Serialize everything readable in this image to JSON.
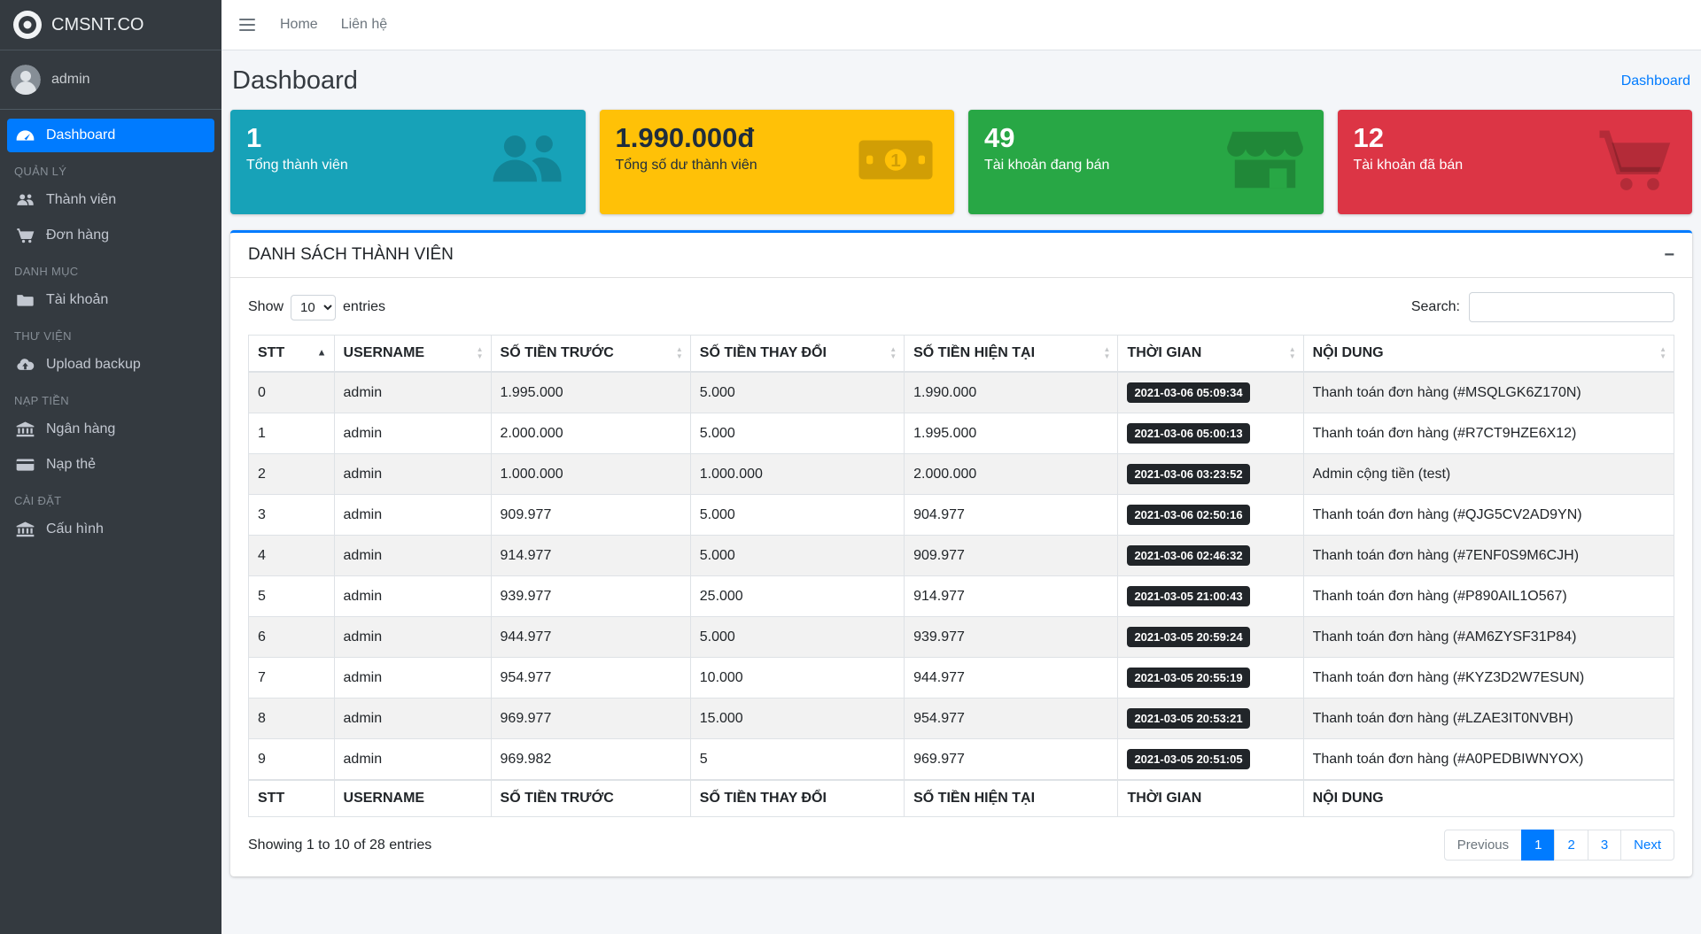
{
  "brand": {
    "title": "CMSNT.CO"
  },
  "navbar": {
    "links": [
      {
        "label": "Home"
      },
      {
        "label": "Liên hệ"
      }
    ]
  },
  "sidebar": {
    "user": {
      "name": "admin"
    },
    "sections": [
      {
        "header": "",
        "items": [
          {
            "label": "Dashboard",
            "icon": "tachometer",
            "active": true
          }
        ]
      },
      {
        "header": "QUẢN LÝ",
        "items": [
          {
            "label": "Thành viên",
            "icon": "users"
          },
          {
            "label": "Đơn hàng",
            "icon": "cart"
          }
        ]
      },
      {
        "header": "DANH MỤC",
        "items": [
          {
            "label": "Tài khoản",
            "icon": "folder"
          }
        ]
      },
      {
        "header": "THƯ VIỆN",
        "items": [
          {
            "label": "Upload backup",
            "icon": "cloud-upload"
          }
        ]
      },
      {
        "header": "NẠP TIỀN",
        "items": [
          {
            "label": "Ngân hàng",
            "icon": "bank"
          },
          {
            "label": "Nạp thẻ",
            "icon": "credit-card"
          }
        ]
      },
      {
        "header": "CÀI ĐẶT",
        "items": [
          {
            "label": "Cấu hình",
            "icon": "bank"
          }
        ]
      }
    ]
  },
  "page": {
    "title": "Dashboard",
    "breadcrumb": "Dashboard"
  },
  "stat_cards": [
    {
      "value": "1",
      "label": "Tổng thành viên",
      "color": "#17a2b8",
      "text": "#ffffff",
      "icon": "users-icon"
    },
    {
      "value": "1.990.000đ",
      "label": "Tổng số dư thành viên",
      "color": "#ffc107",
      "text": "#1f2d3d",
      "icon": "money-icon"
    },
    {
      "value": "49",
      "label": "Tài khoản đang bán",
      "color": "#28a745",
      "text": "#ffffff",
      "icon": "store-icon"
    },
    {
      "value": "12",
      "label": "Tài khoản đã bán",
      "color": "#dc3545",
      "text": "#ffffff",
      "icon": "cart-icon"
    }
  ],
  "panel": {
    "title": "DANH SÁCH THÀNH VIÊN",
    "show_label": "Show",
    "entries_value": "10",
    "entries_label": "entries",
    "search_label": "Search:",
    "table": {
      "columns": [
        "STT",
        "USERNAME",
        "SỐ TIỀN TRƯỚC",
        "SỐ TIỀN THAY ĐỔI",
        "SỐ TIỀN HIỆN TẠI",
        "THỜI GIAN",
        "NỘI DUNG"
      ],
      "sorted_column": 0,
      "rows": [
        [
          "0",
          "admin",
          "1.995.000",
          "5.000",
          "1.990.000",
          "2021-03-06 05:09:34",
          "Thanh toán đơn hàng (#MSQLGK6Z170N)"
        ],
        [
          "1",
          "admin",
          "2.000.000",
          "5.000",
          "1.995.000",
          "2021-03-06 05:00:13",
          "Thanh toán đơn hàng (#R7CT9HZE6X12)"
        ],
        [
          "2",
          "admin",
          "1.000.000",
          "1.000.000",
          "2.000.000",
          "2021-03-06 03:23:52",
          "Admin cộng tiền (test)"
        ],
        [
          "3",
          "admin",
          "909.977",
          "5.000",
          "904.977",
          "2021-03-06 02:50:16",
          "Thanh toán đơn hàng (#QJG5CV2AD9YN)"
        ],
        [
          "4",
          "admin",
          "914.977",
          "5.000",
          "909.977",
          "2021-03-06 02:46:32",
          "Thanh toán đơn hàng (#7ENF0S9M6CJH)"
        ],
        [
          "5",
          "admin",
          "939.977",
          "25.000",
          "914.977",
          "2021-03-05 21:00:43",
          "Thanh toán đơn hàng (#P890AIL1O567)"
        ],
        [
          "6",
          "admin",
          "944.977",
          "5.000",
          "939.977",
          "2021-03-05 20:59:24",
          "Thanh toán đơn hàng (#AM6ZYSF31P84)"
        ],
        [
          "7",
          "admin",
          "954.977",
          "10.000",
          "944.977",
          "2021-03-05 20:55:19",
          "Thanh toán đơn hàng (#KYZ3D2W7ESUN)"
        ],
        [
          "8",
          "admin",
          "969.977",
          "15.000",
          "954.977",
          "2021-03-05 20:53:21",
          "Thanh toán đơn hàng (#LZAE3IT0NVBH)"
        ],
        [
          "9",
          "admin",
          "969.982",
          "5",
          "969.977",
          "2021-03-05 20:51:05",
          "Thanh toán đơn hàng (#A0PEDBIWNYOX)"
        ]
      ]
    },
    "footer": {
      "info": "Showing 1 to 10 of 28 entries",
      "pagination": {
        "prev": "Previous",
        "pages": [
          "1",
          "2",
          "3"
        ],
        "next": "Next",
        "active": "1"
      }
    }
  },
  "colors": {
    "primary": "#007bff",
    "sidebar": "#343a40",
    "badge": "#212529"
  }
}
